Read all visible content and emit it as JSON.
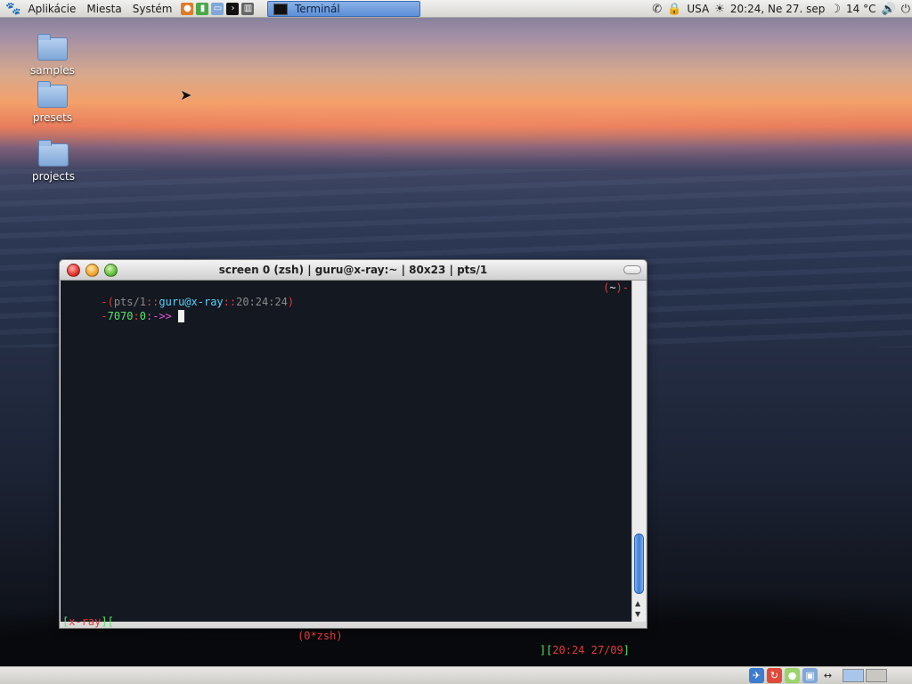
{
  "top_panel": {
    "menus": [
      "Aplikácie",
      "Miesta",
      "Systém"
    ],
    "task": {
      "label": "Terminál"
    },
    "tray": {
      "keyboard_layout": "USA",
      "clock": "20:24, Ne 27. sep",
      "temperature": "14 °C"
    }
  },
  "desktop": {
    "icons": [
      {
        "label": "samples"
      },
      {
        "label": "presets"
      },
      {
        "label": "projects"
      }
    ]
  },
  "terminal": {
    "title": "screen 0 (zsh) | guru@x-ray:~ | 80x23 | pts/1",
    "prompt_line1": {
      "open": "-(",
      "tty": "pts/1",
      "sep1": "::",
      "user_host": "guru@x-ray",
      "sep2": "::",
      "time": "20:24:24",
      "close": ")",
      "dir_open": "(",
      "dir": "~",
      "dir_close": ")-"
    },
    "prompt_line2": {
      "lead": "-",
      "pid": "7070",
      "sep": ":",
      "win": "0",
      "arrow": ":->>"
    },
    "status": {
      "left_bracket": "[",
      "host": "x-ray",
      "left_close": "][",
      "window_list": "(0*zsh)",
      "right_open": "][",
      "datetime": "20:24 27/09",
      "right_close": "]"
    }
  },
  "colors": {
    "term_bg": "#141820",
    "accent_red": "#e23b3b",
    "accent_cyan": "#55d4ff",
    "accent_green": "#55e86a",
    "accent_magenta": "#e05ae0",
    "task_active": "#5c8fd7"
  }
}
